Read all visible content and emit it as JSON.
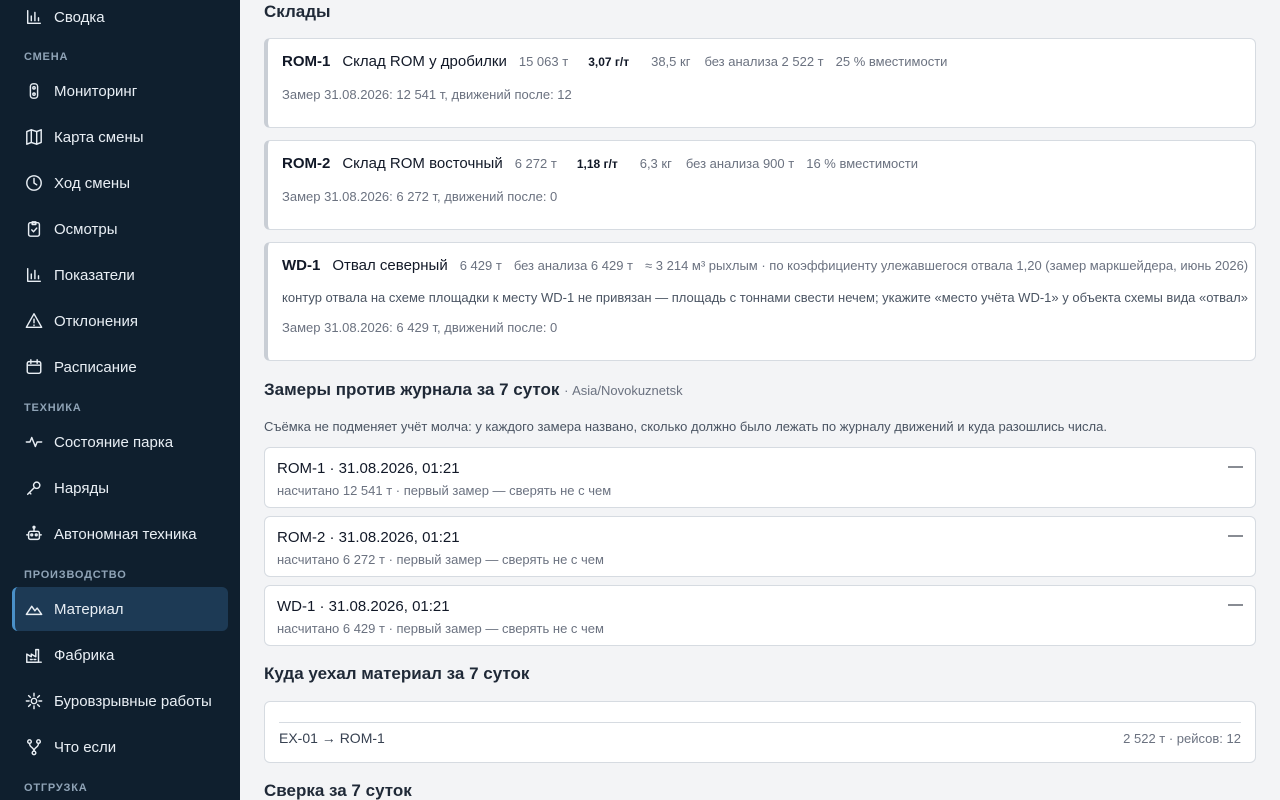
{
  "sidebar": {
    "items_top": [
      {
        "label": "Сводка",
        "icon": "bar-chart-icon"
      }
    ],
    "sections": [
      {
        "label": "СМЕНА"
      },
      {
        "label": "ТЕХНИКА"
      },
      {
        "label": "ПРОИЗВОДСТВО"
      },
      {
        "label": "ОТГРУЗКА"
      }
    ],
    "items": [
      {
        "label": "Мониторинг",
        "icon": "traffic-light-icon"
      },
      {
        "label": "Карта смены",
        "icon": "map-icon"
      },
      {
        "label": "Ход смены",
        "icon": "clock-icon"
      },
      {
        "label": "Осмотры",
        "icon": "clipboard-check-icon"
      },
      {
        "label": "Показатели",
        "icon": "bar-chart-icon"
      },
      {
        "label": "Отклонения",
        "icon": "warning-icon"
      },
      {
        "label": "Расписание",
        "icon": "calendar-icon"
      },
      {
        "label": "Состояние парка",
        "icon": "pulse-icon"
      },
      {
        "label": "Наряды",
        "icon": "wrench-icon"
      },
      {
        "label": "Автономная техника",
        "icon": "robot-icon"
      },
      {
        "label": "Материал",
        "icon": "mountain-icon",
        "active": true
      },
      {
        "label": "Фабрика",
        "icon": "factory-icon"
      },
      {
        "label": "Буровзрывные работы",
        "icon": "blast-icon"
      },
      {
        "label": "Что если",
        "icon": "branch-icon"
      }
    ]
  },
  "main": {
    "warehouses_title": "Склады",
    "warehouses": [
      {
        "code": "ROM-1",
        "name": "Склад ROM у дробилки",
        "tons": "15 063 т",
        "grade": "3,07 г/т",
        "metal": "38,5 кг",
        "unanalyzed": "без анализа 2 522 т",
        "capacity": "25 % вместимости",
        "meta": "Замер 31.08.2026: 12 541 т, движений после: 12"
      },
      {
        "code": "ROM-2",
        "name": "Склад ROM восточный",
        "tons": "6 272 т",
        "grade": "1,18 г/т",
        "metal": "6,3 кг",
        "unanalyzed": "без анализа 900 т",
        "capacity": "16 % вместимости",
        "meta": "Замер 31.08.2026: 6 272 т, движений после: 0"
      },
      {
        "code": "WD-1",
        "name": "Отвал северный",
        "tons": "6 429 т",
        "unanalyzed": "без анализа 6 429 т",
        "volume": "≈ 3 214 м³ рыхлым · по коэффициенту улежавшегося отвала 1,20 (замер маркшейдера, июнь 2026)",
        "warning": "контур отвала на схеме площадки к месту WD-1 не привязан — площадь с тоннами свести нечем; укажите «место учёта WD-1» у объекта схемы вида «отвал»",
        "meta": "Замер 31.08.2026: 6 429 т, движений после: 0"
      }
    ],
    "measurements_title": "Замеры против журнала за 7 суток",
    "measurements_tz": "· Asia/Novokuznetsk",
    "measurements_note": "Съёмка не подменяет учёт молча: у каждого замера названо, сколько должно было лежать по журналу движений и куда разошлись числа.",
    "measurements": [
      {
        "title": "ROM-1 · 31.08.2026, 01:21",
        "sub": "насчитано 12 541 т · первый замер — сверять не с чем",
        "diff": "—"
      },
      {
        "title": "ROM-2 · 31.08.2026, 01:21",
        "sub": "насчитано 6 272 т · первый замер — сверять не с чем",
        "diff": "—"
      },
      {
        "title": "WD-1 · 31.08.2026, 01:21",
        "sub": "насчитано 6 429 т · первый замер — сверять не с чем",
        "diff": "—"
      }
    ],
    "flows_title": "Куда уехал материал за 7 суток",
    "flows": [
      {
        "route": "EX-01 → ROM-1",
        "summary": "2 522 т · рейсов: 12"
      }
    ],
    "reconcile_title": "Сверка за 7 суток"
  }
}
